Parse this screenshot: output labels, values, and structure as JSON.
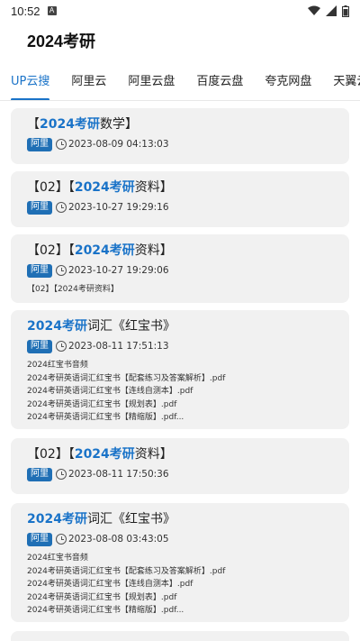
{
  "status": {
    "time": "10:52",
    "a_label": "A"
  },
  "header": {
    "title": "2024考研"
  },
  "tabs": [
    {
      "label": "UP云搜",
      "active": true
    },
    {
      "label": "阿里云",
      "active": false
    },
    {
      "label": "阿里云盘",
      "active": false
    },
    {
      "label": "百度云盘",
      "active": false
    },
    {
      "label": "夸克网盘",
      "active": false
    },
    {
      "label": "天翼云盘",
      "active": false
    }
  ],
  "cards": [
    {
      "title_pre": "【",
      "title_hl": "2024考研",
      "title_post": "数学】",
      "badge": "阿里",
      "time": "2023-08-09 04:13:03",
      "files": []
    },
    {
      "title_pre": "【02】【",
      "title_hl": "2024考研",
      "title_post": "资料】",
      "badge": "阿里",
      "time": "2023-10-27 19:29:16",
      "files": []
    },
    {
      "title_pre": "【02】【",
      "title_hl": "2024考研",
      "title_post": "资料】",
      "badge": "阿里",
      "time": "2023-10-27 19:29:06",
      "files": [
        "【02】【2024考研资料】"
      ]
    },
    {
      "title_pre": "",
      "title_hl": "2024考研",
      "title_post": "词汇《红宝书》",
      "badge": "阿里",
      "time": "2023-08-11 17:51:13",
      "files": [
        "2024红宝书音频",
        "2024考研英语词汇红宝书【配套练习及答案解析】.pdf",
        "2024考研英语词汇红宝书【连线自测本】.pdf",
        "2024考研英语词汇红宝书【规划表】.pdf",
        "2024考研英语词汇红宝书【精缩版】.pdf..."
      ]
    },
    {
      "title_pre": "【02】【",
      "title_hl": "2024考研",
      "title_post": "资料】",
      "badge": "阿里",
      "time": "2023-08-11 17:50:36",
      "files": []
    },
    {
      "title_pre": "",
      "title_hl": "2024考研",
      "title_post": "词汇《红宝书》",
      "badge": "阿里",
      "time": "2023-08-08 03:43:05",
      "files": [
        "2024红宝书音频",
        "2024考研英语词汇红宝书【配套练习及答案解析】.pdf",
        "2024考研英语词汇红宝书【连线自测本】.pdf",
        "2024考研英语词汇红宝书【规划表】.pdf",
        "2024考研英语词汇红宝书【精缩版】.pdf..."
      ]
    }
  ]
}
